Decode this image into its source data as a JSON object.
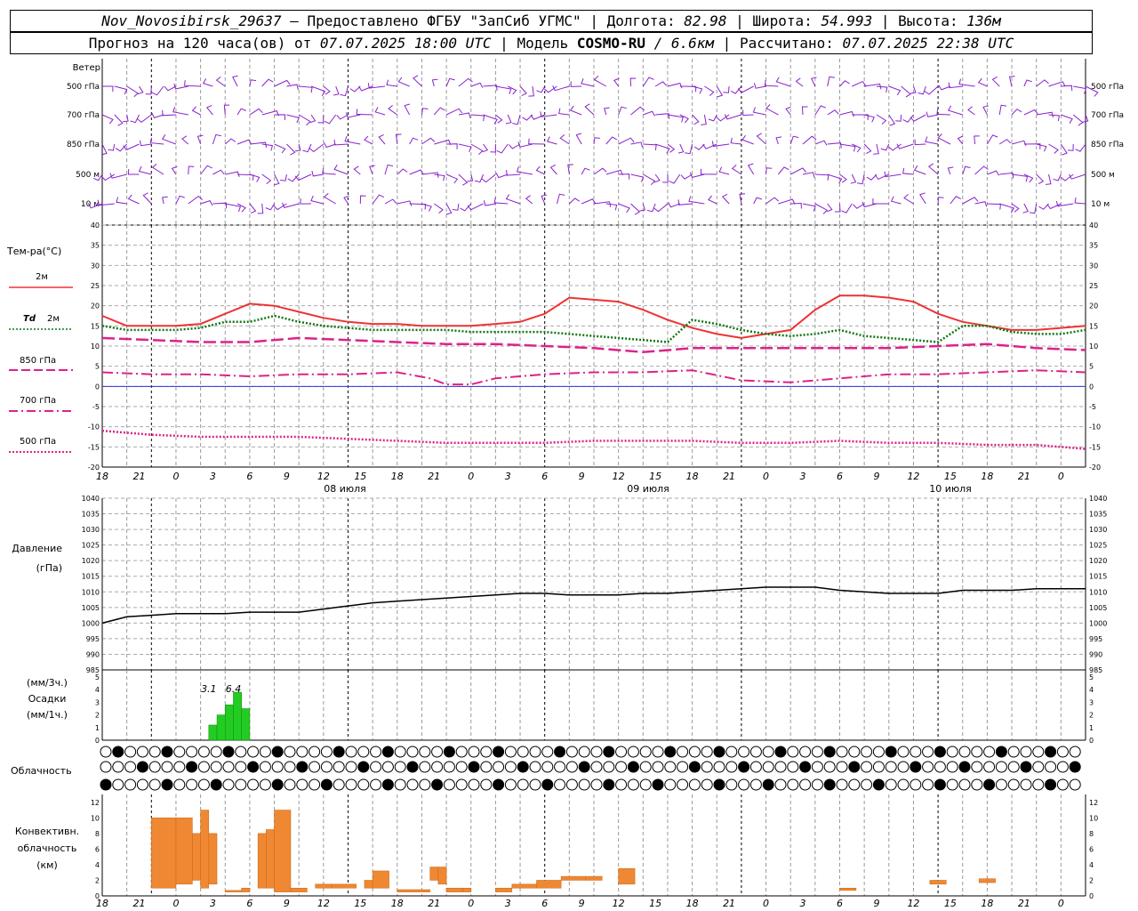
{
  "header": {
    "station": "Nov_Novosibirsk_29637",
    "provider": "— Предоставлено ФГБУ \"ЗапСиб УГМС\"",
    "lon_label": "Долгота:",
    "lon": "82.98",
    "lat_label": "Широта:",
    "lat": "54.993",
    "alt_label": "Высота:",
    "alt": "136м",
    "forecast_prefix": "Прогноз на 120 часа(ов) от",
    "forecast_time": "07.07.2025 18:00 UTC",
    "model_label": "Модель",
    "model_name": "COSMO-RU",
    "model_res": "/ 6.6км",
    "calc_label": "Рассчитано:",
    "calc_time": "07.07.2025 22:38 UTC"
  },
  "colors": {
    "wind": "#8822cc",
    "t2m": "#ee3333",
    "td2m": "#117711",
    "t850": "#dd2288",
    "zero": "#3333cc",
    "precip": "#22cc22",
    "conv": "#ee8833"
  },
  "chart_data": [
    {
      "type": "wind-barbs",
      "title": "Ветер",
      "levels": [
        "500 гПа",
        "700 гПа",
        "850 гПа",
        "500 м",
        "10 м"
      ]
    },
    {
      "type": "line",
      "title": "Тем-ра(°C)",
      "ylim": [
        -20,
        40
      ],
      "yticks": [
        40,
        35,
        30,
        25,
        20,
        15,
        10,
        5,
        0,
        -5,
        -10,
        -15,
        -20
      ],
      "xticks": [
        "18",
        "21",
        "0",
        "3",
        "6",
        "9",
        "12",
        "15",
        "18",
        "21",
        "0",
        "3",
        "6",
        "9",
        "12",
        "15",
        "18",
        "21",
        "0",
        "3",
        "6",
        "9",
        "12",
        "15",
        "18",
        "21",
        "0"
      ],
      "dates": [
        "08 июля",
        "09 июля",
        "10 июля"
      ],
      "series": [
        {
          "name": "2м",
          "style": "solid",
          "x": [
            0,
            3,
            6,
            9,
            12,
            15,
            18,
            21,
            24,
            27,
            30,
            33,
            36,
            39,
            42,
            45,
            48,
            51,
            54,
            57,
            60,
            63,
            66,
            69,
            72,
            75,
            78,
            81,
            84,
            87,
            90,
            93,
            96,
            99,
            102,
            105,
            108,
            111,
            114,
            117,
            120
          ],
          "values": [
            17.5,
            15,
            15,
            15,
            15.5,
            18,
            20.5,
            20,
            18.5,
            17,
            16,
            15.5,
            15.5,
            15,
            15,
            15,
            15.5,
            16,
            18,
            22,
            21.5,
            21,
            19,
            16.5,
            14.5,
            13,
            12,
            13,
            14,
            19,
            22.5,
            22.5,
            22,
            21,
            18,
            16,
            15,
            14,
            14,
            14.5,
            15
          ]
        },
        {
          "name": "Td 2м",
          "style": "dotted",
          "x": [
            0,
            3,
            6,
            9,
            12,
            15,
            18,
            21,
            24,
            27,
            30,
            33,
            36,
            39,
            42,
            45,
            48,
            51,
            54,
            57,
            60,
            63,
            66,
            69,
            72,
            75,
            78,
            81,
            84,
            87,
            90,
            93,
            96,
            99,
            102,
            105,
            108,
            111,
            114,
            117,
            120
          ],
          "values": [
            15,
            14,
            14,
            14,
            14.5,
            16,
            16,
            17.5,
            16,
            15,
            14.5,
            14,
            14,
            14,
            14,
            13.5,
            13.5,
            13.5,
            13.5,
            13,
            12.5,
            12,
            11.5,
            11,
            16.5,
            15.5,
            14,
            13,
            12.5,
            13,
            14,
            12.5,
            12,
            11.5,
            11,
            15,
            15,
            13.5,
            13,
            13,
            14
          ]
        },
        {
          "name": "850 гПа",
          "style": "dashed",
          "x": [
            0,
            6,
            12,
            18,
            24,
            30,
            36,
            42,
            48,
            54,
            60,
            66,
            72,
            78,
            84,
            90,
            96,
            102,
            108,
            114,
            120
          ],
          "values": [
            12,
            11.5,
            11,
            11,
            12,
            11.5,
            11,
            10.5,
            10.5,
            10,
            9.5,
            8.5,
            9.5,
            9.5,
            9.5,
            9.5,
            9.5,
            10,
            10.5,
            9.5,
            9
          ]
        },
        {
          "name": "700 гПа",
          "style": "dashdot",
          "x": [
            0,
            6,
            12,
            18,
            24,
            30,
            36,
            40,
            42,
            45,
            48,
            54,
            60,
            66,
            72,
            78,
            84,
            90,
            96,
            102,
            108,
            114,
            120
          ],
          "values": [
            3.5,
            3,
            3,
            2.5,
            3,
            3,
            3.5,
            2,
            0.5,
            0.5,
            2,
            3,
            3.5,
            3.5,
            4,
            1.5,
            1,
            2,
            3,
            3,
            3.5,
            4,
            3.5
          ]
        },
        {
          "name": "500 гПа",
          "style": "densedot",
          "x": [
            0,
            6,
            12,
            18,
            24,
            30,
            36,
            42,
            48,
            54,
            60,
            66,
            72,
            78,
            84,
            90,
            96,
            102,
            108,
            114,
            120
          ],
          "values": [
            -11,
            -12,
            -12.5,
            -12.5,
            -12.5,
            -13,
            -13.5,
            -14,
            -14,
            -14,
            -13.5,
            -13.5,
            -13.5,
            -14,
            -14,
            -13.5,
            -14,
            -14,
            -14.5,
            -14.5,
            -15.5
          ]
        }
      ]
    },
    {
      "type": "line",
      "title": "Давление",
      "ylabel": "(гПа)",
      "ylim": [
        985,
        1040
      ],
      "yticks": [
        1040,
        1035,
        1030,
        1025,
        1020,
        1015,
        1010,
        1005,
        1000,
        995,
        990,
        985
      ],
      "series": [
        {
          "name": "pressure",
          "x": [
            0,
            3,
            6,
            9,
            12,
            15,
            18,
            21,
            24,
            27,
            30,
            33,
            36,
            39,
            42,
            45,
            48,
            51,
            54,
            57,
            60,
            63,
            66,
            69,
            72,
            75,
            78,
            81,
            84,
            87,
            90,
            93,
            96,
            99,
            102,
            105,
            108,
            111,
            114,
            117,
            120
          ],
          "values": [
            1000,
            1002,
            1002.5,
            1003,
            1003,
            1003,
            1003.5,
            1003.5,
            1003.5,
            1004.5,
            1005.5,
            1006.5,
            1007,
            1007.5,
            1008,
            1008.5,
            1009,
            1009.5,
            1009.5,
            1009,
            1009,
            1009,
            1009.5,
            1009.5,
            1010,
            1010.5,
            1011,
            1011.5,
            1011.5,
            1011.5,
            1010.5,
            1010,
            1009.5,
            1009.5,
            1009.5,
            1010.5,
            1010.5,
            1010.5,
            1011,
            1011,
            1011
          ]
        }
      ]
    },
    {
      "type": "bar",
      "title": "Осадки",
      "ylabel_top": "(мм/3ч.)",
      "ylabel_bottom": "(мм/1ч.)",
      "ylim": [
        0,
        5
      ],
      "annotations": [
        {
          "x_label": "3.1",
          "x": 13
        },
        {
          "x_label": "6.4",
          "x": 16
        }
      ],
      "x": [
        11,
        12,
        13,
        14,
        15,
        16,
        17,
        18
      ],
      "values": [
        0,
        0,
        1.2,
        2,
        2.8,
        3.8,
        2.5,
        0
      ]
    },
    {
      "type": "symbol-grid",
      "title": "Облачность",
      "rows": 3,
      "columns": 80
    },
    {
      "type": "bar",
      "title": "Конвективн. облачность (км)",
      "ylim": [
        0,
        13
      ],
      "yticks": [
        12,
        10,
        8,
        6,
        4,
        2,
        0
      ],
      "bars": [
        {
          "x0": 6,
          "x1": 9,
          "lo": 1,
          "hi": 10
        },
        {
          "x0": 9,
          "x1": 11,
          "lo": 1.5,
          "hi": 10
        },
        {
          "x0": 11,
          "x1": 12,
          "lo": 2,
          "hi": 8
        },
        {
          "x0": 12,
          "x1": 13,
          "lo": 1,
          "hi": 11
        },
        {
          "x0": 13,
          "x1": 14,
          "lo": 1.5,
          "hi": 8
        },
        {
          "x0": 15,
          "x1": 17,
          "lo": 0.5,
          "hi": 0.7
        },
        {
          "x0": 17,
          "x1": 18,
          "lo": 0.5,
          "hi": 1
        },
        {
          "x0": 19,
          "x1": 20,
          "lo": 1,
          "hi": 8
        },
        {
          "x0": 20,
          "x1": 21,
          "lo": 1,
          "hi": 8.5
        },
        {
          "x0": 21,
          "x1": 23,
          "lo": 0.5,
          "hi": 11
        },
        {
          "x0": 23,
          "x1": 25,
          "lo": 0.5,
          "hi": 1
        },
        {
          "x0": 26,
          "x1": 28,
          "lo": 1,
          "hi": 1.5
        },
        {
          "x0": 28,
          "x1": 31,
          "lo": 1,
          "hi": 1.5
        },
        {
          "x0": 32,
          "x1": 33,
          "lo": 1,
          "hi": 2
        },
        {
          "x0": 33,
          "x1": 35,
          "lo": 1,
          "hi": 3.2
        },
        {
          "x0": 36,
          "x1": 40,
          "lo": 0.5,
          "hi": 0.8
        },
        {
          "x0": 40,
          "x1": 41,
          "lo": 2,
          "hi": 3.7
        },
        {
          "x0": 41,
          "x1": 42,
          "lo": 1.5,
          "hi": 3.7
        },
        {
          "x0": 42,
          "x1": 44,
          "lo": 0.5,
          "hi": 1
        },
        {
          "x0": 44,
          "x1": 45,
          "lo": 0.5,
          "hi": 1
        },
        {
          "x0": 48,
          "x1": 50,
          "lo": 0.5,
          "hi": 1
        },
        {
          "x0": 50,
          "x1": 53,
          "lo": 1,
          "hi": 1.5
        },
        {
          "x0": 53,
          "x1": 56,
          "lo": 1,
          "hi": 2
        },
        {
          "x0": 56,
          "x1": 59,
          "lo": 2,
          "hi": 2.5
        },
        {
          "x0": 59,
          "x1": 61,
          "lo": 2,
          "hi": 2.5
        },
        {
          "x0": 63,
          "x1": 65,
          "lo": 1.5,
          "hi": 3.5
        },
        {
          "x0": 90,
          "x1": 92,
          "lo": 0.7,
          "hi": 1
        },
        {
          "x0": 101,
          "x1": 103,
          "lo": 1.5,
          "hi": 2
        },
        {
          "x0": 107,
          "x1": 109,
          "lo": 1.7,
          "hi": 2.2
        }
      ]
    }
  ],
  "axis_labels": {
    "wind": "Ветер",
    "temp": "Тем-ра(°C)",
    "legend_2m": "2м",
    "legend_td": "Td",
    "legend_td2": "2м",
    "legend_850": "850 гПа",
    "legend_700": "700 гПа",
    "legend_500": "500 гПа",
    "pressure1": "Давление",
    "pressure2": "(гПа)",
    "precip1": "(мм/3ч.)",
    "precip2": "Осадки",
    "precip3": "(мм/1ч.)",
    "cloud": "Облачность",
    "conv1": "Конвективн.",
    "conv2": "облачность",
    "conv3": "(км)"
  }
}
